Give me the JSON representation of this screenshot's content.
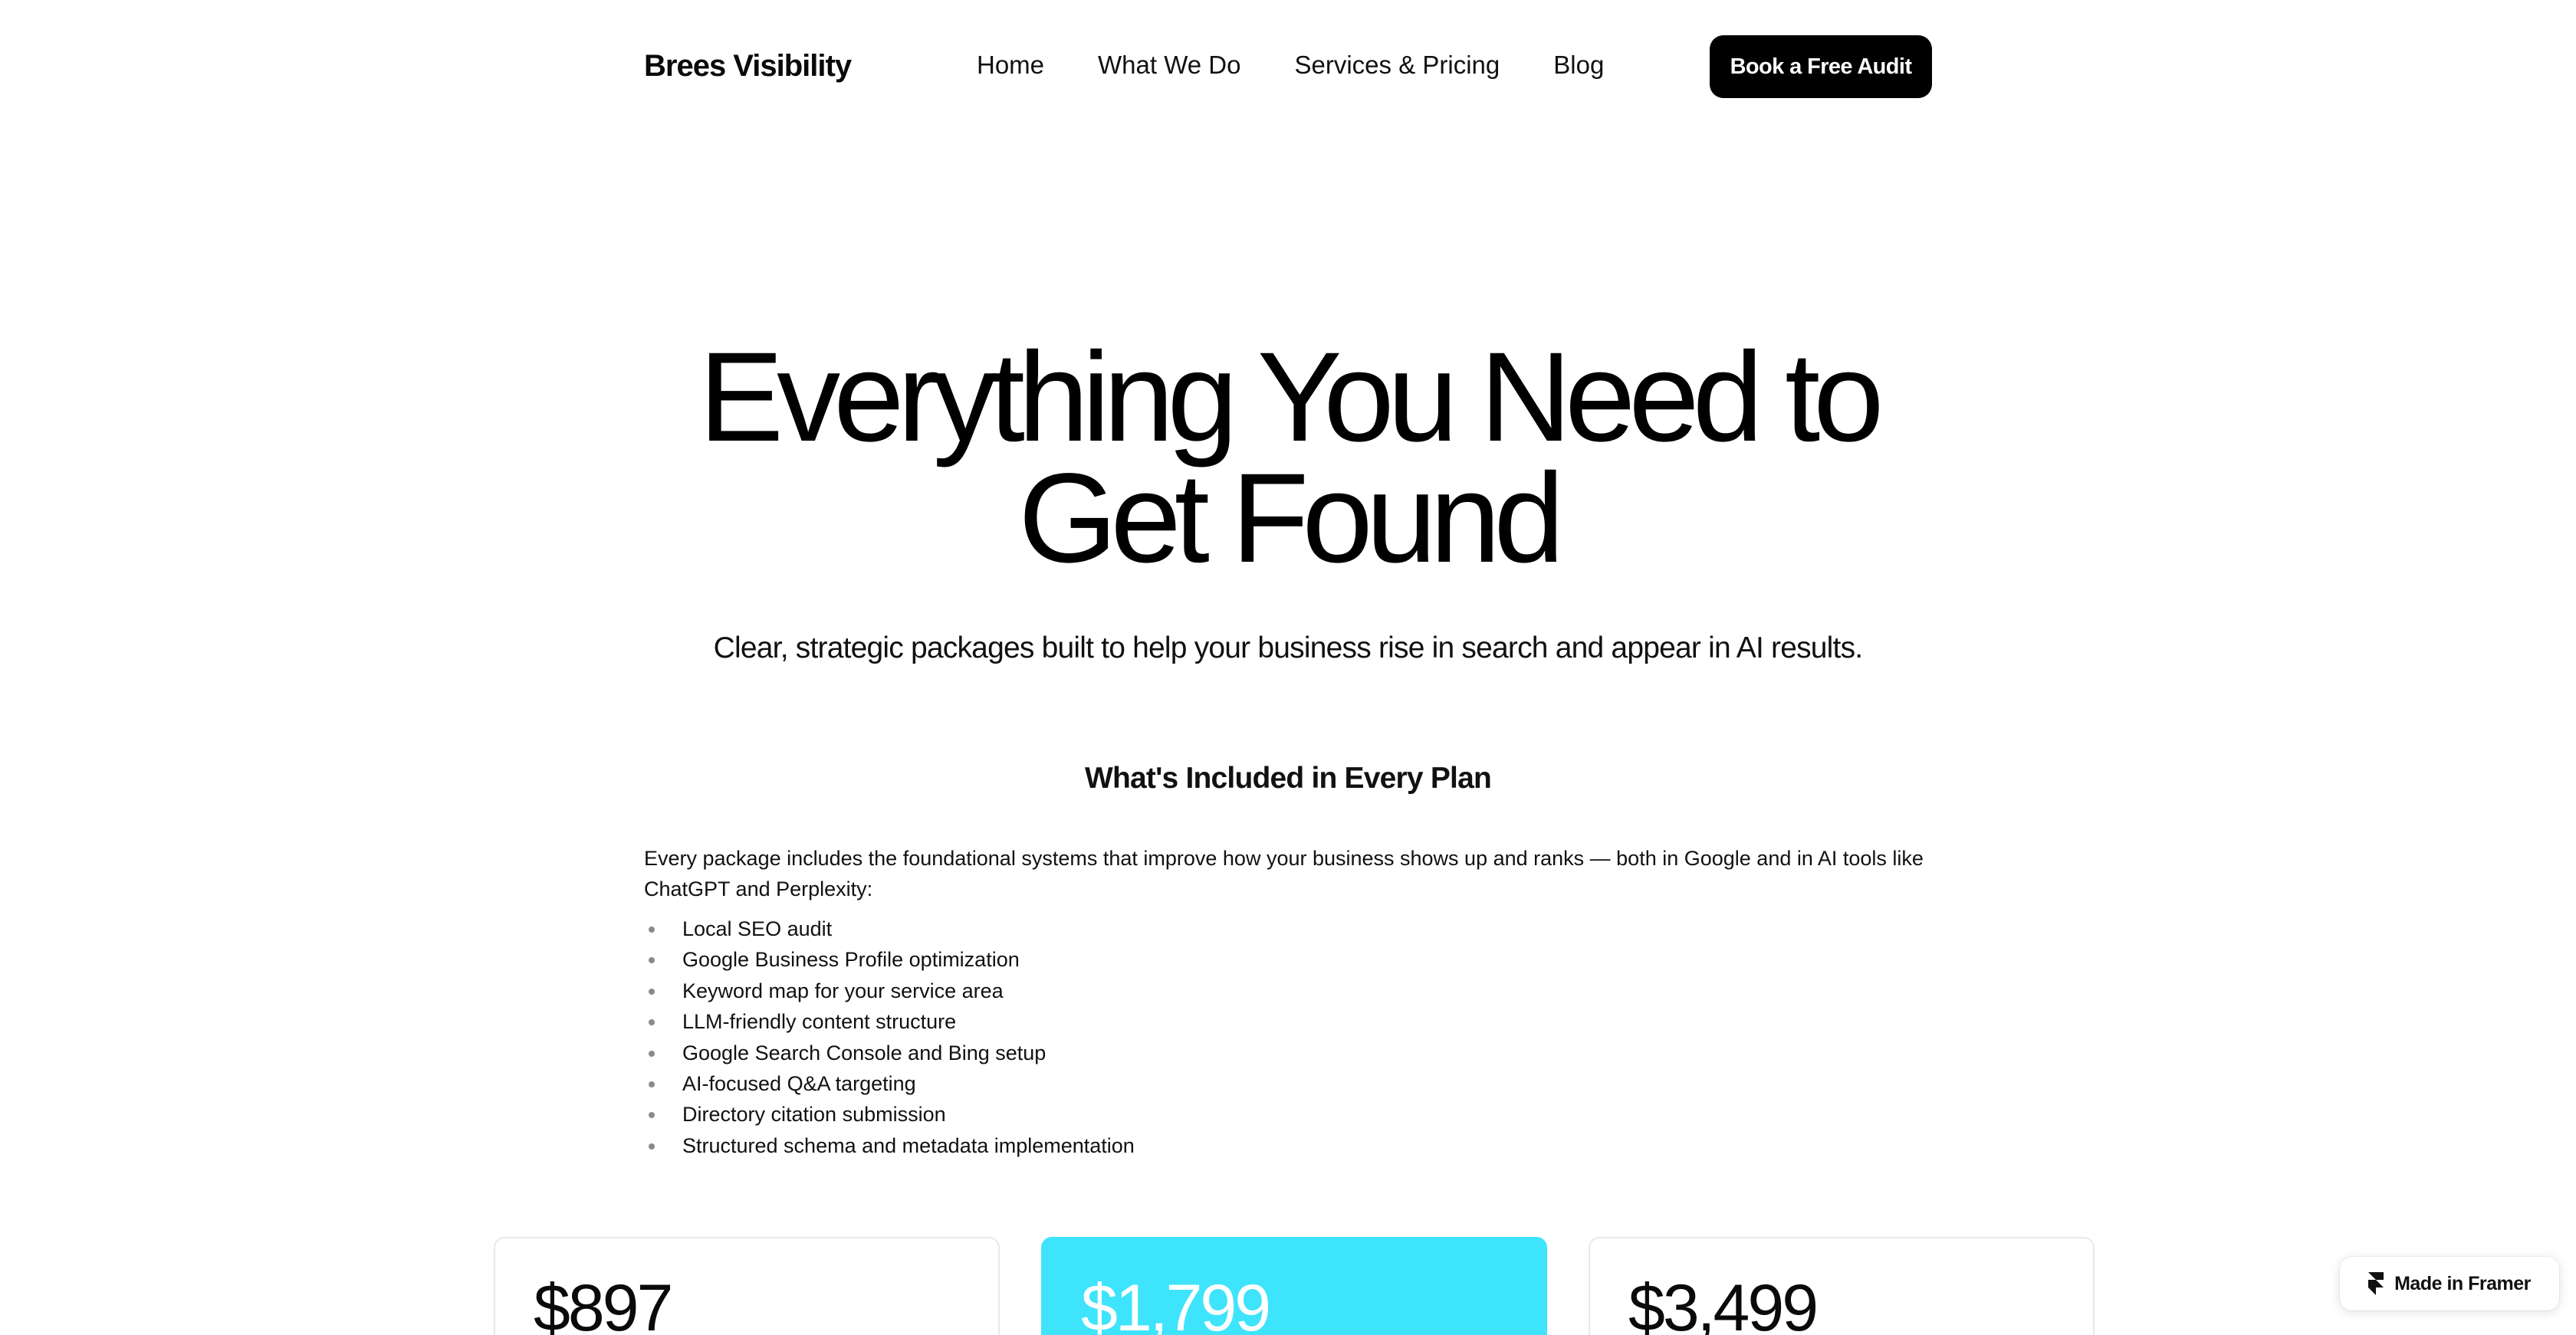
{
  "header": {
    "brand": "Brees Visibility",
    "nav": [
      "Home",
      "What We Do",
      "Services & Pricing",
      "Blog"
    ],
    "cta_label": "Book a Free Audit"
  },
  "hero": {
    "title_line1": "Everything You Need to",
    "title_line2": "Get Found",
    "subtitle": "Clear, strategic packages built to help your business rise in search and appear in AI results."
  },
  "included": {
    "heading": "What's Included in Every Plan",
    "intro": "Every package includes the foundational systems that improve how your business shows up and ranks — both in Google and in AI tools like ChatGPT and Perplexity:",
    "items": [
      "Local SEO audit",
      "Google Business Profile optimization",
      "Keyword map for your service area",
      "LLM-friendly content structure",
      "Google Search Console and Bing setup",
      "AI-focused Q&A targeting",
      "Directory citation submission",
      "Structured schema and metadata implementation"
    ]
  },
  "pricing": {
    "cards": [
      {
        "price": "$897"
      },
      {
        "price": "$1,799"
      },
      {
        "price": "$3,499"
      }
    ],
    "featured_color": "#3ee4fb"
  },
  "badge": {
    "label": "Made in Framer",
    "icon": "framer-logo-icon"
  }
}
